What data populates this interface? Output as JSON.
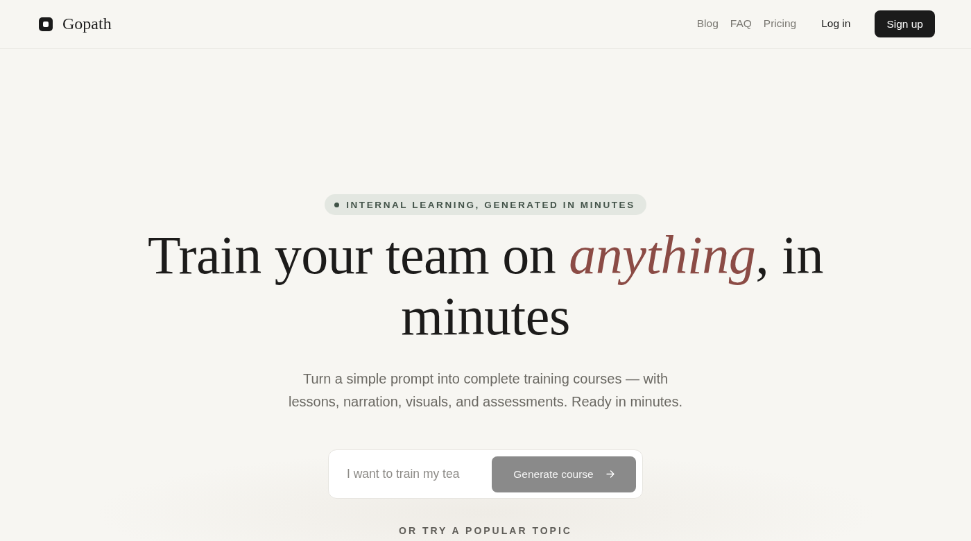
{
  "header": {
    "logo": {
      "name": "Gopath"
    },
    "nav": [
      {
        "label": "Blog"
      },
      {
        "label": "FAQ"
      },
      {
        "label": "Pricing"
      }
    ],
    "login": "Log in",
    "signup": "Sign up"
  },
  "hero": {
    "badge": "INTERNAL LEARNING, GENERATED IN MINUTES",
    "headline": "Train your team on *anything*, in minutes",
    "subtitle": "Turn a simple prompt into complete training courses — with lessons, narration, visuals, and assessments. Ready in minutes.",
    "prompt": {
      "placeholder": "I want to train my tea",
      "button": {
        "label": "Generate course",
        "disabled": true
      }
    },
    "topics_label": "OR TRY A POPULAR TOPIC"
  }
}
